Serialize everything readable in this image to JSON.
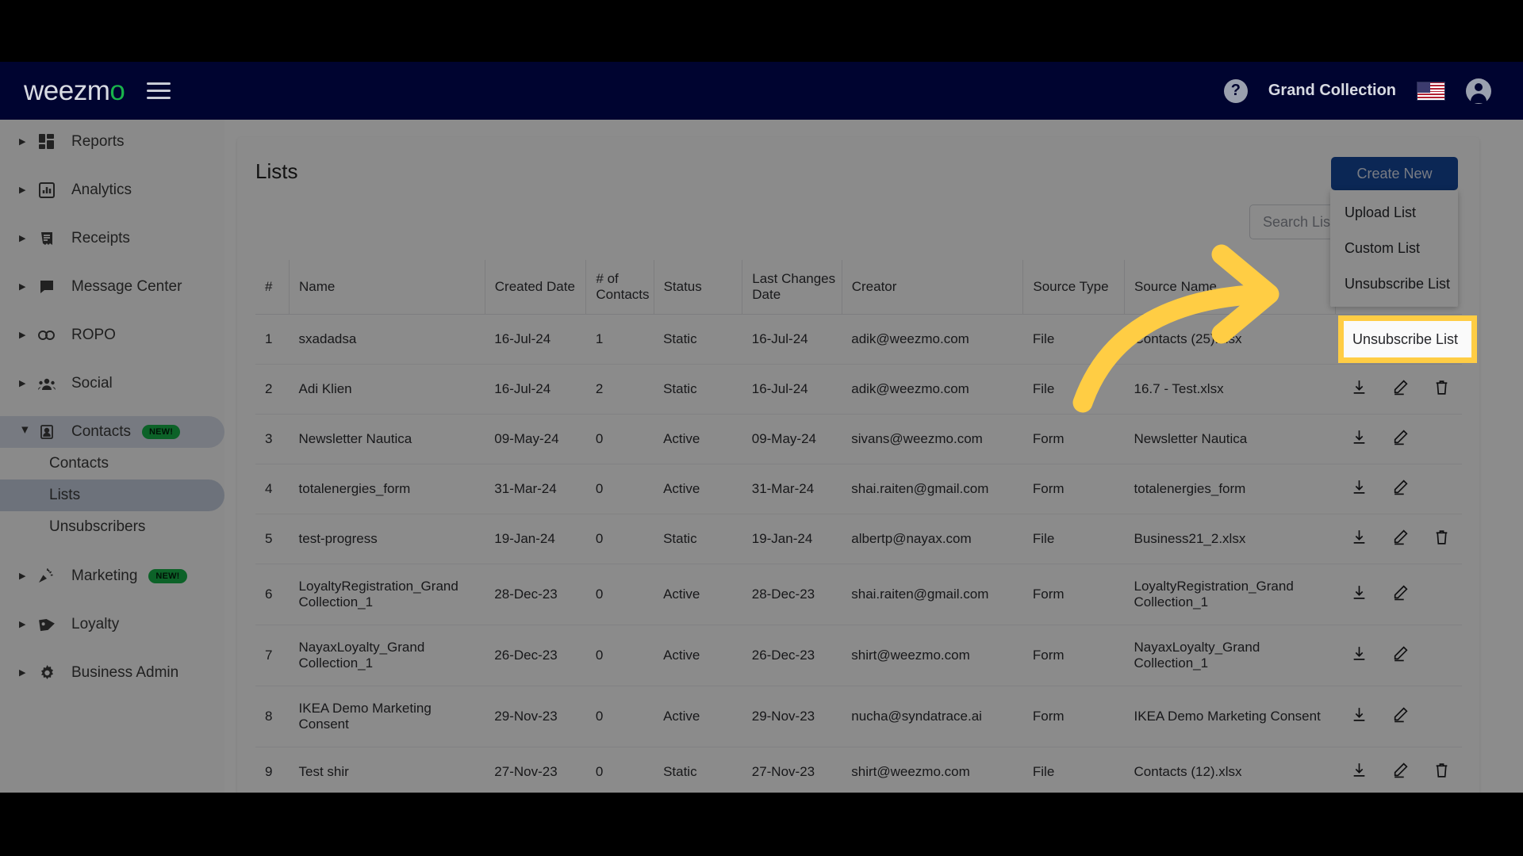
{
  "navbar": {
    "logo_text_main": "weezm",
    "logo_text_accent": "o",
    "menu_icon": "hamburger-icon",
    "help_icon": "help-circle-icon",
    "business_name": "Grand Collection",
    "flag_icon": "us-flag-icon",
    "account_icon": "account-circle-icon"
  },
  "sidebar": {
    "items": [
      {
        "label": "Reports",
        "icon": "dashboard-grid-icon",
        "expanded": false,
        "badge": ""
      },
      {
        "label": "Analytics",
        "icon": "bar-chart-icon",
        "expanded": false,
        "badge": ""
      },
      {
        "label": "Receipts",
        "icon": "receipt-icon",
        "expanded": false,
        "badge": ""
      },
      {
        "label": "Message Center",
        "icon": "chat-bubble-icon",
        "expanded": false,
        "badge": ""
      },
      {
        "label": "ROPO",
        "icon": "infinity-icon",
        "expanded": false,
        "badge": ""
      },
      {
        "label": "Social",
        "icon": "people-group-icon",
        "expanded": false,
        "badge": ""
      },
      {
        "label": "Contacts",
        "icon": "contact-card-icon",
        "expanded": true,
        "badge": "NEW!"
      },
      {
        "label": "Marketing",
        "icon": "megaphone-icon",
        "expanded": false,
        "badge": "NEW!"
      },
      {
        "label": "Loyalty",
        "icon": "tag-icon",
        "expanded": false,
        "badge": ""
      },
      {
        "label": "Business Admin",
        "icon": "gear-icon",
        "expanded": false,
        "badge": ""
      }
    ],
    "contacts_subitems": [
      {
        "label": "Contacts",
        "active": false
      },
      {
        "label": "Lists",
        "active": true
      },
      {
        "label": "Unsubscribers",
        "active": false
      }
    ]
  },
  "main": {
    "title": "Lists",
    "create_button": "Create New",
    "search_placeholder": "Search List Name",
    "search_value": "",
    "dropdown": {
      "items": [
        "Upload List",
        "Custom List",
        "Unsubscribe List"
      ],
      "highlighted_item": "Unsubscribe List"
    },
    "table": {
      "headers": [
        "#",
        "Name",
        "Created Date",
        "# of Contacts",
        "Status",
        "Last Changes Date",
        "Creator",
        "Source Type",
        "Source Name",
        ""
      ],
      "rows": [
        {
          "num": "1",
          "name": "sxadadsa",
          "created": "16-Jul-24",
          "contacts": "1",
          "status": "Static",
          "changed": "16-Jul-24",
          "creator": "adik@weezmo.com",
          "source_type": "File",
          "source_name": "Contacts (25).xlsx",
          "can_delete": true
        },
        {
          "num": "2",
          "name": "Adi Klien",
          "created": "16-Jul-24",
          "contacts": "2",
          "status": "Static",
          "changed": "16-Jul-24",
          "creator": "adik@weezmo.com",
          "source_type": "File",
          "source_name": "16.7 - Test.xlsx",
          "can_delete": true
        },
        {
          "num": "3",
          "name": "Newsletter Nautica",
          "created": "09-May-24",
          "contacts": "0",
          "status": "Active",
          "changed": "09-May-24",
          "creator": "sivans@weezmo.com",
          "source_type": "Form",
          "source_name": "Newsletter Nautica",
          "can_delete": false
        },
        {
          "num": "4",
          "name": "totalenergies_form",
          "created": "31-Mar-24",
          "contacts": "0",
          "status": "Active",
          "changed": "31-Mar-24",
          "creator": "shai.raiten@gmail.com",
          "source_type": "Form",
          "source_name": "totalenergies_form",
          "can_delete": false
        },
        {
          "num": "5",
          "name": "test-progress",
          "created": "19-Jan-24",
          "contacts": "0",
          "status": "Static",
          "changed": "19-Jan-24",
          "creator": "albertp@nayax.com",
          "source_type": "File",
          "source_name": "Business21_2.xlsx",
          "can_delete": true
        },
        {
          "num": "6",
          "name": "LoyaltyRegistration_Grand Collection_1",
          "created": "28-Dec-23",
          "contacts": "0",
          "status": "Active",
          "changed": "28-Dec-23",
          "creator": "shai.raiten@gmail.com",
          "source_type": "Form",
          "source_name": "LoyaltyRegistration_Grand Collection_1",
          "can_delete": false
        },
        {
          "num": "7",
          "name": "NayaxLoyalty_Grand Collection_1",
          "created": "26-Dec-23",
          "contacts": "0",
          "status": "Active",
          "changed": "26-Dec-23",
          "creator": "shirt@weezmo.com",
          "source_type": "Form",
          "source_name": "NayaxLoyalty_Grand Collection_1",
          "can_delete": false
        },
        {
          "num": "8",
          "name": "IKEA Demo Marketing Consent",
          "created": "29-Nov-23",
          "contacts": "0",
          "status": "Active",
          "changed": "29-Nov-23",
          "creator": "nucha@syndatrace.ai",
          "source_type": "Form",
          "source_name": "IKEA Demo Marketing Consent",
          "can_delete": false
        },
        {
          "num": "9",
          "name": "Test shir",
          "created": "27-Nov-23",
          "contacts": "0",
          "status": "Static",
          "changed": "27-Nov-23",
          "creator": "shirt@weezmo.com",
          "source_type": "File",
          "source_name": "Contacts (12).xlsx",
          "can_delete": true
        }
      ],
      "row_action_icons": [
        "download-icon",
        "edit-pencil-icon",
        "delete-trash-icon"
      ]
    }
  },
  "annotation": {
    "arrow_icon": "curved-arrow-icon",
    "highlight_label": "Unsubscribe List",
    "highlight_color": "#ffcd44"
  },
  "colors": {
    "navbar_bg": "#000430",
    "brand_accent": "#19b34b",
    "primary_button": "#14479b",
    "highlight": "#ffcd44",
    "badge_new": "#17b34a"
  }
}
